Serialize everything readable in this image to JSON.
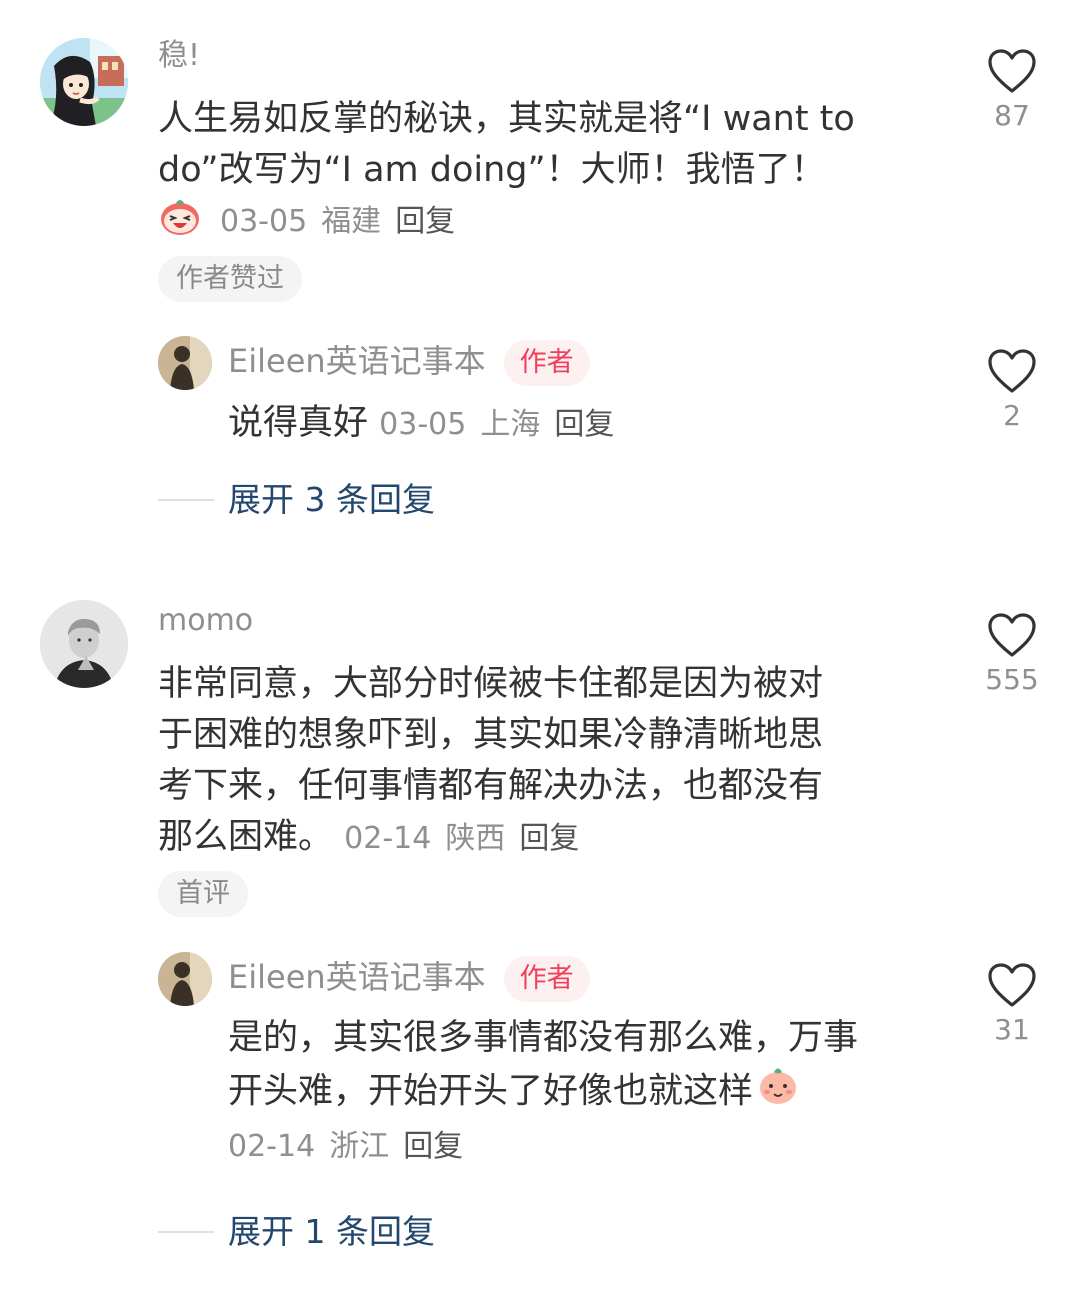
{
  "comments": [
    {
      "username": "稳!",
      "text_lines": [
        "人生易如反掌的秘诀，其实就是将“I want to",
        "do”改写为“I am doing”！大师！我悟了！"
      ],
      "date": "03-05",
      "region": "福建",
      "reply_label": "回复",
      "tag": "作者赞过",
      "likes": "87",
      "avatar_icon": "anime-girl-avatar",
      "meta_emoji": "laughing-peach-emoji",
      "author_reply": {
        "username": "Eileen英语记事本",
        "badge": "作者",
        "text": "说得真好",
        "date": "03-05",
        "region": "上海",
        "reply_label": "回复",
        "likes": "2"
      },
      "expand_label": "展开 3 条回复"
    },
    {
      "username": "momo",
      "text_lines": [
        "非常同意，大部分时候被卡住都是因为被对",
        "于困难的想象吓到，其实如果冷静清晰地思",
        "考下来，任何事情都有解决办法，也都没有",
        "那么困难。"
      ],
      "date": "02-14",
      "region": "陕西",
      "reply_label": "回复",
      "tag": "首评",
      "likes": "555",
      "avatar_icon": "man-portrait-avatar",
      "author_reply": {
        "username": "Eileen英语记事本",
        "badge": "作者",
        "text_lines": [
          "是的，其实很多事情都没有那么难，万事",
          "开头难，开始开头了好像也就这样"
        ],
        "date": "02-14",
        "region": "浙江",
        "reply_label": "回复",
        "likes": "31",
        "emoji": "shy-peach-emoji"
      },
      "expand_label": "展开 1 条回复"
    }
  ],
  "colors": {
    "text": "#333333",
    "meta": "#8f8f8f",
    "link": "#24476e",
    "author_badge_text": "#f0405b",
    "author_badge_bg": "#fdf0f1",
    "tag_bg": "#f4f4f4"
  }
}
